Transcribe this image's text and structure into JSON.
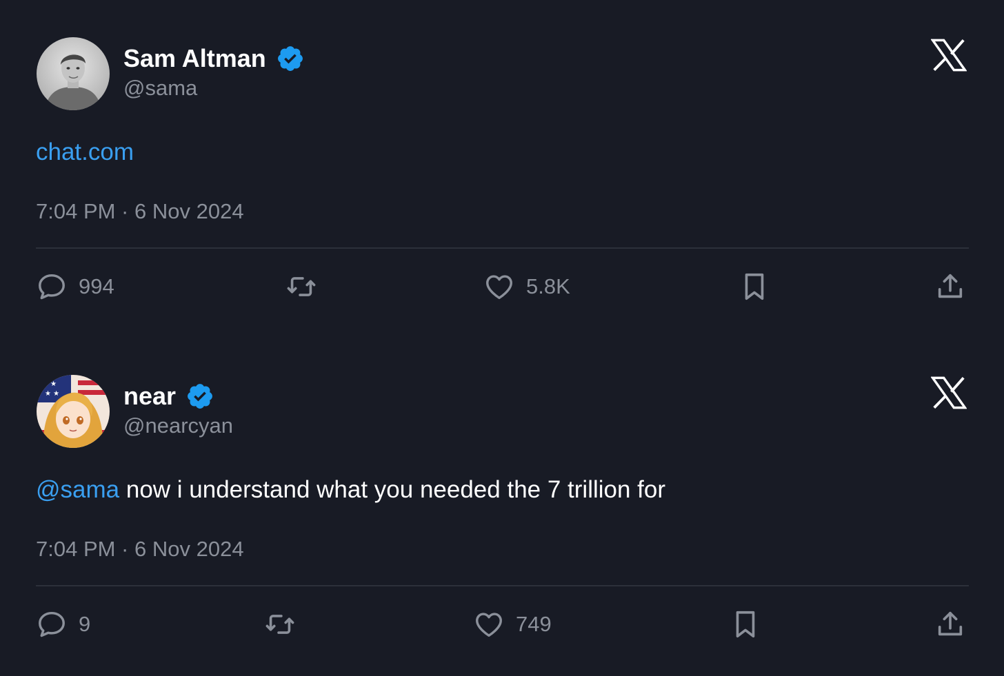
{
  "tweets": [
    {
      "author": {
        "display_name": "Sam Altman",
        "handle": "@sama",
        "verified": true,
        "avatar": "avatar-grayscale-photo"
      },
      "text_link": "chat.com",
      "text_plain": "",
      "timestamp": "7:04 PM · 6 Nov 2024",
      "actions": {
        "replies": "994",
        "retweets": "",
        "likes": "5.8K"
      }
    },
    {
      "author": {
        "display_name": "near",
        "handle": "@nearcyan",
        "verified": true,
        "avatar": "avatar-anime-character"
      },
      "text_link": "@sama",
      "text_plain": " now i understand what you needed the 7 trillion for",
      "timestamp": "7:04 PM · 6 Nov 2024",
      "actions": {
        "replies": "9",
        "retweets": "",
        "likes": "749"
      }
    }
  ],
  "icons": {
    "platform": "x-logo-icon",
    "verified": "verified-badge-icon",
    "reply": "reply-icon",
    "retweet": "retweet-icon",
    "like": "heart-icon",
    "bookmark": "bookmark-icon",
    "share": "share-icon"
  },
  "colors": {
    "background": "#181b25",
    "link": "#3a9ff0",
    "verified": "#1d9bf0",
    "muted_text": "#8b909a",
    "divider": "#2c303a"
  }
}
